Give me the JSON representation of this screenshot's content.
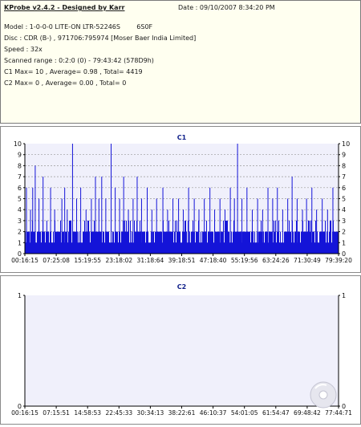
{
  "info": {
    "app_title": "KProbe v2.4.2 - Designed by Karr",
    "date": "Date : 09/10/2007 8:34:20 PM",
    "model": "Model : 1-0-0-0 LITE-ON LTR-52246S        6S0F",
    "disc": "Disc : CDR (B-) , 971706:795974 [Moser Baer India Limited]",
    "speed": "Speed : 32x",
    "scanned_range": "Scanned range : 0:2:0 (0) - 79:43:42 (578D9h)",
    "c1_stats": "C1 Max= 10 , Average= 0.98 , Total= 4419",
    "c2_stats": "C2 Max= 0 , Average= 0.00 , Total= 0"
  },
  "colors": {
    "background": "#ffffff",
    "info_bg": "#fffff0",
    "plot_bg": "#f0f0fb",
    "bars": "#1414d8",
    "grid": "#9a9a9a",
    "title": "#10208a"
  },
  "chart_data": [
    {
      "type": "bar",
      "title": "C1",
      "ylim": [
        0,
        10
      ],
      "yticks": [
        "0",
        "1",
        "2",
        "3",
        "4",
        "5",
        "6",
        "7",
        "8",
        "9",
        "10"
      ],
      "xtick_labels": [
        "00:16:15",
        "07:25:08",
        "15:19:55",
        "23:18:02",
        "31:18:64",
        "39:18:51",
        "47:18:40",
        "55:19:56",
        "63:24:26",
        "71:30:49",
        "79:39:20"
      ],
      "grid": true,
      "max": 10,
      "average": 0.98,
      "total": 4419,
      "spikes": [
        {
          "x": 0.005,
          "y": 6
        },
        {
          "x": 0.018,
          "y": 4
        },
        {
          "x": 0.025,
          "y": 6
        },
        {
          "x": 0.033,
          "y": 8
        },
        {
          "x": 0.045,
          "y": 5
        },
        {
          "x": 0.058,
          "y": 7
        },
        {
          "x": 0.07,
          "y": 3
        },
        {
          "x": 0.082,
          "y": 6
        },
        {
          "x": 0.095,
          "y": 4
        },
        {
          "x": 0.118,
          "y": 5
        },
        {
          "x": 0.127,
          "y": 6
        },
        {
          "x": 0.135,
          "y": 4
        },
        {
          "x": 0.152,
          "y": 10
        },
        {
          "x": 0.165,
          "y": 5
        },
        {
          "x": 0.178,
          "y": 6
        },
        {
          "x": 0.195,
          "y": 4
        },
        {
          "x": 0.212,
          "y": 5
        },
        {
          "x": 0.225,
          "y": 7
        },
        {
          "x": 0.236,
          "y": 5
        },
        {
          "x": 0.245,
          "y": 7
        },
        {
          "x": 0.258,
          "y": 5
        },
        {
          "x": 0.275,
          "y": 10
        },
        {
          "x": 0.288,
          "y": 6
        },
        {
          "x": 0.302,
          "y": 5
        },
        {
          "x": 0.315,
          "y": 7
        },
        {
          "x": 0.33,
          "y": 4
        },
        {
          "x": 0.345,
          "y": 5
        },
        {
          "x": 0.358,
          "y": 7
        },
        {
          "x": 0.372,
          "y": 5
        },
        {
          "x": 0.39,
          "y": 6
        },
        {
          "x": 0.405,
          "y": 4
        },
        {
          "x": 0.42,
          "y": 5
        },
        {
          "x": 0.44,
          "y": 6
        },
        {
          "x": 0.455,
          "y": 4
        },
        {
          "x": 0.472,
          "y": 5
        },
        {
          "x": 0.49,
          "y": 5
        },
        {
          "x": 0.505,
          "y": 4
        },
        {
          "x": 0.522,
          "y": 6
        },
        {
          "x": 0.54,
          "y": 5
        },
        {
          "x": 0.555,
          "y": 4
        },
        {
          "x": 0.572,
          "y": 5
        },
        {
          "x": 0.59,
          "y": 6
        },
        {
          "x": 0.605,
          "y": 4
        },
        {
          "x": 0.622,
          "y": 5
        },
        {
          "x": 0.638,
          "y": 4
        },
        {
          "x": 0.655,
          "y": 6
        },
        {
          "x": 0.668,
          "y": 5
        },
        {
          "x": 0.678,
          "y": 10
        },
        {
          "x": 0.692,
          "y": 5
        },
        {
          "x": 0.708,
          "y": 6
        },
        {
          "x": 0.725,
          "y": 4
        },
        {
          "x": 0.742,
          "y": 5
        },
        {
          "x": 0.758,
          "y": 4
        },
        {
          "x": 0.775,
          "y": 6
        },
        {
          "x": 0.79,
          "y": 5
        },
        {
          "x": 0.805,
          "y": 6
        },
        {
          "x": 0.822,
          "y": 4
        },
        {
          "x": 0.838,
          "y": 5
        },
        {
          "x": 0.852,
          "y": 7
        },
        {
          "x": 0.868,
          "y": 5
        },
        {
          "x": 0.885,
          "y": 4
        },
        {
          "x": 0.898,
          "y": 5
        },
        {
          "x": 0.915,
          "y": 6
        },
        {
          "x": 0.93,
          "y": 4
        },
        {
          "x": 0.948,
          "y": 5
        },
        {
          "x": 0.965,
          "y": 4
        },
        {
          "x": 0.982,
          "y": 6
        }
      ]
    },
    {
      "type": "bar",
      "title": "C2",
      "ylim": [
        0,
        1
      ],
      "yticks": [
        "0",
        "1"
      ],
      "xtick_labels": [
        "00:16:15",
        "07:15:51",
        "14:58:53",
        "22:45:33",
        "30:34:13",
        "38:22:61",
        "46:10:37",
        "54:01:05",
        "61:54:47",
        "69:48:42",
        "77:44:71"
      ],
      "grid": false,
      "max": 0,
      "average": 0.0,
      "total": 0,
      "spikes": []
    }
  ]
}
